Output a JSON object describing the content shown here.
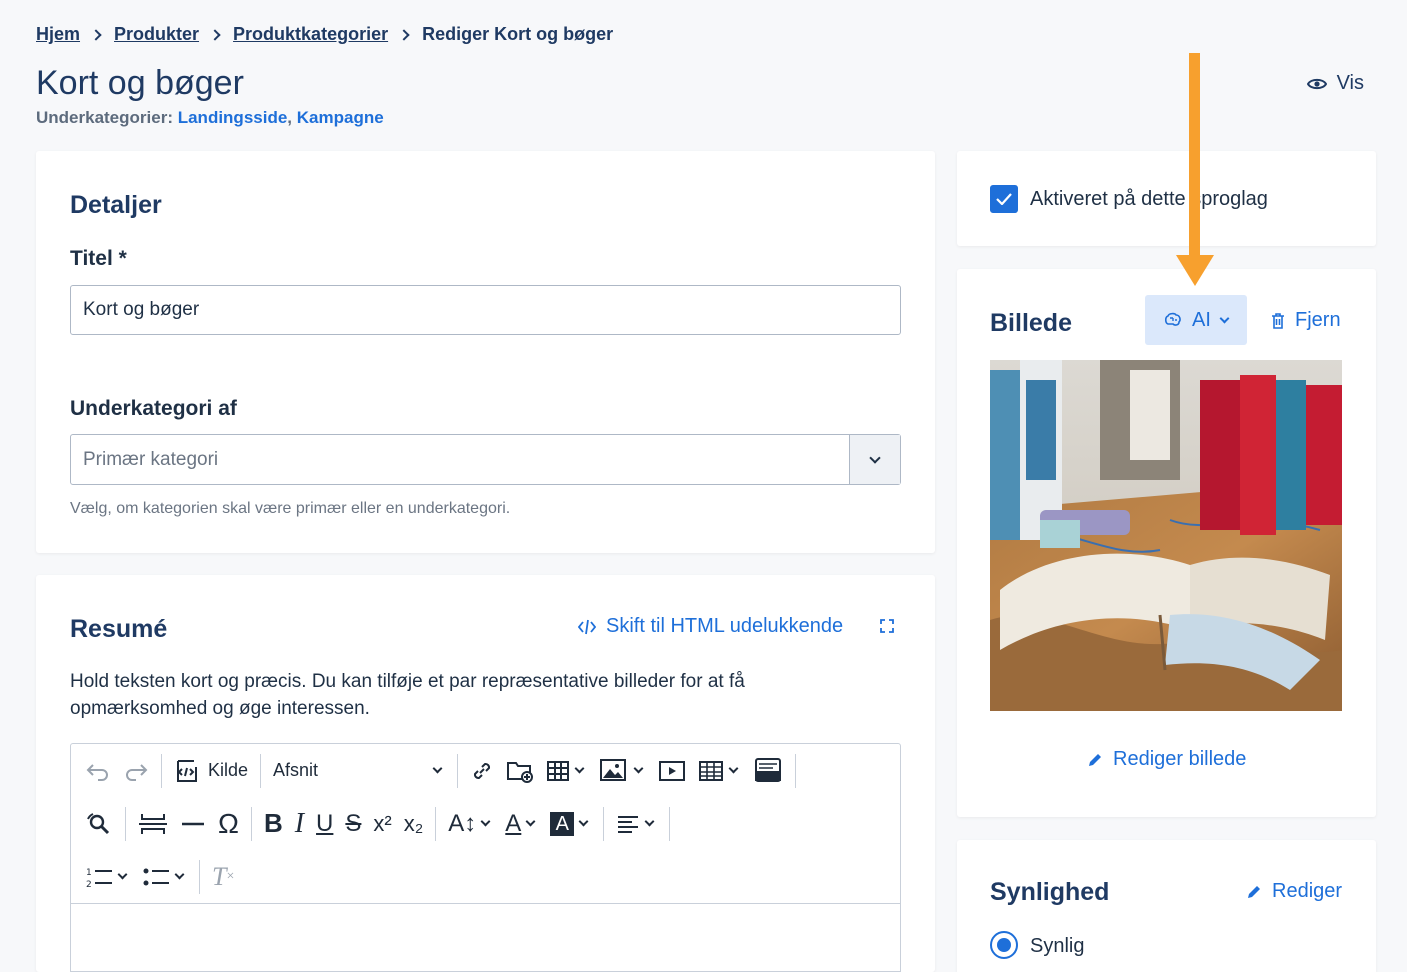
{
  "breadcrumb": {
    "items": [
      "Hjem",
      "Produkter",
      "Produktkategorier"
    ],
    "current": "Rediger Kort og bøger"
  },
  "page": {
    "title": "Kort og bøger",
    "subcategories_label": "Underkategorier:",
    "subcategories": [
      "Landingsside",
      "Kampagne"
    ],
    "view_label": "Vis"
  },
  "details": {
    "heading": "Detaljer",
    "title_label": "Titel *",
    "title_value": "Kort og bøger",
    "parent_label": "Underkategori af",
    "parent_placeholder": "Primær kategori",
    "parent_help": "Vælg, om kategorien skal være primær eller en underkategori."
  },
  "summary": {
    "heading": "Resumé",
    "html_toggle": "Skift til HTML udelukkende",
    "description": "Hold teksten kort og præcis. Du kan tilføje et par repræsentative billeder for at få opmærksomhed og øge interessen.",
    "toolbar": {
      "source_label": "Kilde",
      "format_label": "Afsnit"
    }
  },
  "activation": {
    "label": "Aktiveret på dette sproglag",
    "checked": true
  },
  "image": {
    "heading": "Billede",
    "ai_label": "AI",
    "remove_label": "Fjern",
    "edit_label": "Rediger billede"
  },
  "visibility": {
    "heading": "Synlighed",
    "edit_label": "Rediger",
    "option_label": "Synlig"
  },
  "colors": {
    "accent": "#1e6fd9",
    "heading": "#1f3a63",
    "annotation_arrow": "#f7a02e",
    "ai_button_bg": "#dbe8fb"
  }
}
